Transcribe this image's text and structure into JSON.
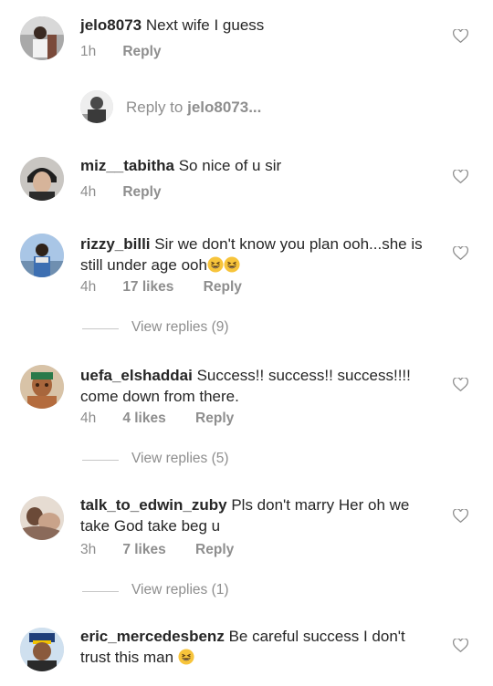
{
  "comments": [
    {
      "username": "jelo8073",
      "text": "Next wife I guess",
      "time": "1h",
      "likes": "",
      "reply_label": "Reply"
    },
    {
      "username": "miz__tabitha",
      "text": "So nice of u sir",
      "time": "4h",
      "likes": "",
      "reply_label": "Reply"
    },
    {
      "username": "rizzy_billi",
      "text": "Sir we don't know you plan ooh...she is still under age ooh",
      "emojis": "😆😆",
      "time": "4h",
      "likes": "17 likes",
      "reply_label": "Reply",
      "view_replies": "View replies (9)"
    },
    {
      "username": "uefa_elshaddai",
      "text": "Success!! success!! success!!!! come down from there.",
      "time": "4h",
      "likes": "4 likes",
      "reply_label": "Reply",
      "view_replies": "View replies (5)"
    },
    {
      "username": "talk_to_edwin_zuby",
      "text": "Pls don't marry Her oh we take God take beg u",
      "time": "3h",
      "likes": "7 likes",
      "reply_label": "Reply",
      "view_replies": "View replies (1)"
    },
    {
      "username": "eric_mercedesbenz",
      "text": "Be careful success I don't trust this man",
      "emojis": "😆"
    }
  ],
  "reply_composer": {
    "prefix": "Reply to",
    "target": "jelo8073..."
  },
  "icons": {
    "like": "heart-outline-icon",
    "laugh": "grinning-squinting-face-emoji"
  },
  "colors": {
    "text": "#262626",
    "secondary": "#8e8e8e",
    "divider": "#c7c7c7",
    "emoji": "#f7c43b"
  }
}
